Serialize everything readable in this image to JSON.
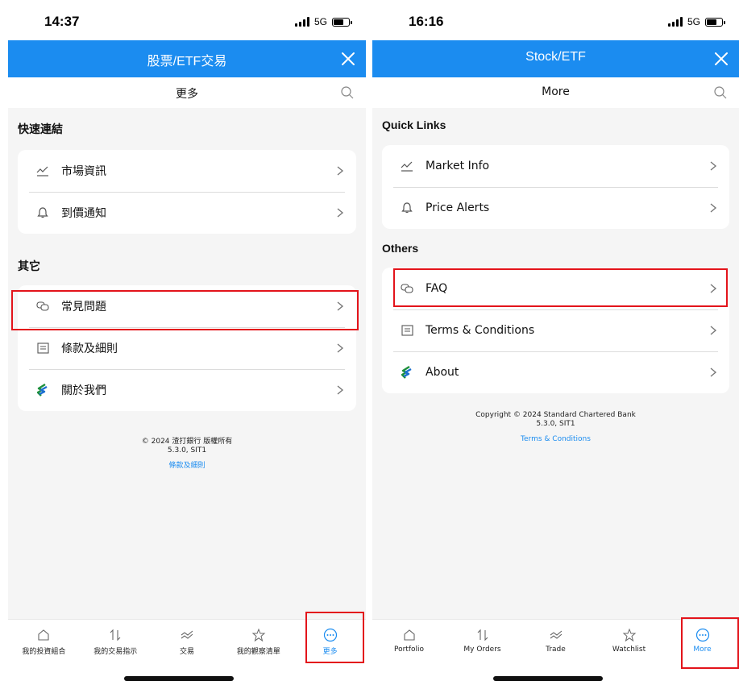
{
  "colors": {
    "accent": "#1b8cf0",
    "highlight": "#e3141b"
  },
  "left": {
    "status": {
      "time": "14:37",
      "network": "5G"
    },
    "header": {
      "title": "股票/ETF交易",
      "close_icon": "close-icon"
    },
    "subheader": {
      "title": "更多",
      "search_icon": "search-icon"
    },
    "quick_links": {
      "title": "快速連結",
      "items": [
        {
          "label": "市場資訊",
          "icon": "market-info-icon"
        },
        {
          "label": "到價通知",
          "icon": "price-alert-icon"
        }
      ]
    },
    "others": {
      "title": "其它",
      "items": [
        {
          "label": "常見問題",
          "icon": "faq-icon"
        },
        {
          "label": "條款及細則",
          "icon": "terms-icon"
        },
        {
          "label": "關於我們",
          "icon": "about-icon"
        }
      ]
    },
    "footer": {
      "copyright": "© 2024 渣打銀行 版權所有",
      "version": "5.3.0, SIT1",
      "terms_link": "條款及細則"
    },
    "nav": [
      {
        "label": "我的投資組合",
        "icon": "home-icon"
      },
      {
        "label": "我的交易指示",
        "icon": "orders-icon"
      },
      {
        "label": "交易",
        "icon": "trade-icon"
      },
      {
        "label": "我的觀察清單",
        "icon": "star-icon"
      },
      {
        "label": "更多",
        "icon": "more-icon"
      }
    ]
  },
  "right": {
    "status": {
      "time": "16:16",
      "network": "5G"
    },
    "header": {
      "title": "Stock/ETF",
      "close_icon": "close-icon"
    },
    "subheader": {
      "title": "More",
      "search_icon": "search-icon"
    },
    "quick_links": {
      "title": "Quick Links",
      "items": [
        {
          "label": "Market Info",
          "icon": "market-info-icon"
        },
        {
          "label": "Price Alerts",
          "icon": "price-alert-icon"
        }
      ]
    },
    "others": {
      "title": "Others",
      "items": [
        {
          "label": "FAQ",
          "icon": "faq-icon"
        },
        {
          "label": "Terms & Conditions",
          "icon": "terms-icon"
        },
        {
          "label": "About",
          "icon": "about-icon"
        }
      ]
    },
    "footer": {
      "copyright": "Copyright © 2024 Standard Chartered Bank",
      "version": "5.3.0, SIT1",
      "terms_link": "Terms & Conditions"
    },
    "nav": [
      {
        "label": "Portfolio",
        "icon": "home-icon"
      },
      {
        "label": "My Orders",
        "icon": "orders-icon"
      },
      {
        "label": "Trade",
        "icon": "trade-icon"
      },
      {
        "label": "Watchlist",
        "icon": "star-icon"
      },
      {
        "label": "More",
        "icon": "more-icon"
      }
    ]
  }
}
